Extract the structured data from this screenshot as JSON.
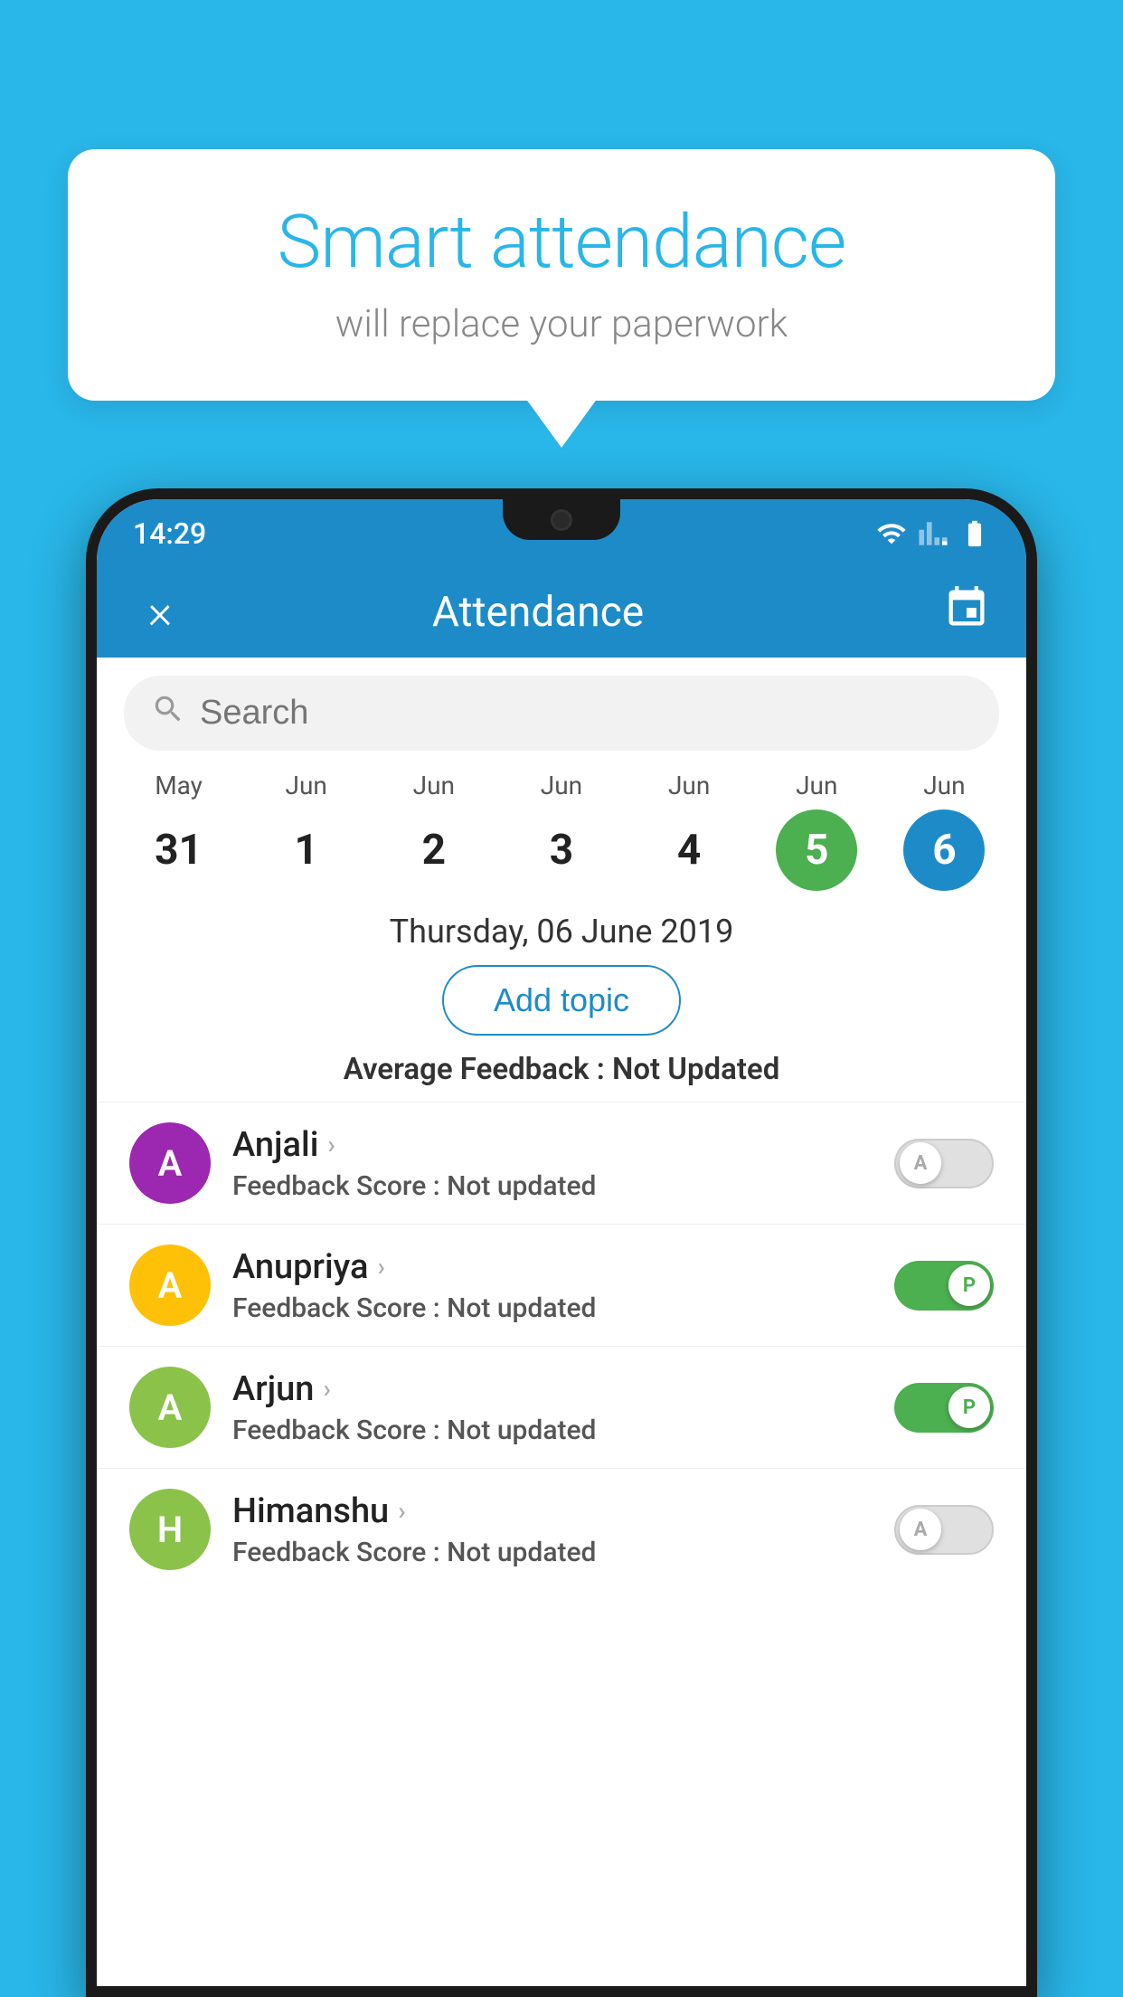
{
  "background_color": "#29b6e8",
  "bubble": {
    "title": "Smart attendance",
    "subtitle": "will replace your paperwork"
  },
  "phone": {
    "status_bar": {
      "time": "14:29"
    },
    "header": {
      "title": "Attendance",
      "close_label": "×",
      "calendar_icon": "calendar-icon"
    },
    "search": {
      "placeholder": "Search"
    },
    "calendar": {
      "days": [
        {
          "month": "May",
          "date": "31",
          "state": "normal"
        },
        {
          "month": "Jun",
          "date": "1",
          "state": "normal"
        },
        {
          "month": "Jun",
          "date": "2",
          "state": "normal"
        },
        {
          "month": "Jun",
          "date": "3",
          "state": "normal"
        },
        {
          "month": "Jun",
          "date": "4",
          "state": "normal"
        },
        {
          "month": "Jun",
          "date": "5",
          "state": "today"
        },
        {
          "month": "Jun",
          "date": "6",
          "state": "selected"
        }
      ]
    },
    "selected_date": "Thursday, 06 June 2019",
    "add_topic_label": "Add topic",
    "average_feedback_label": "Average Feedback : ",
    "average_feedback_value": "Not Updated",
    "students": [
      {
        "name": "Anjali",
        "avatar_letter": "A",
        "avatar_color": "#9c27b0",
        "feedback_label": "Feedback Score : ",
        "feedback_value": "Not updated",
        "toggle_state": "off",
        "toggle_label": "A"
      },
      {
        "name": "Anupriya",
        "avatar_letter": "A",
        "avatar_color": "#ffc107",
        "feedback_label": "Feedback Score : ",
        "feedback_value": "Not updated",
        "toggle_state": "on",
        "toggle_label": "P"
      },
      {
        "name": "Arjun",
        "avatar_letter": "A",
        "avatar_color": "#8bc34a",
        "feedback_label": "Feedback Score : ",
        "feedback_value": "Not updated",
        "toggle_state": "on",
        "toggle_label": "P"
      },
      {
        "name": "Himanshu",
        "avatar_letter": "H",
        "avatar_color": "#8bc34a",
        "feedback_label": "Feedback Score : ",
        "feedback_value": "Not updated",
        "toggle_state": "off",
        "toggle_label": "A"
      }
    ]
  }
}
